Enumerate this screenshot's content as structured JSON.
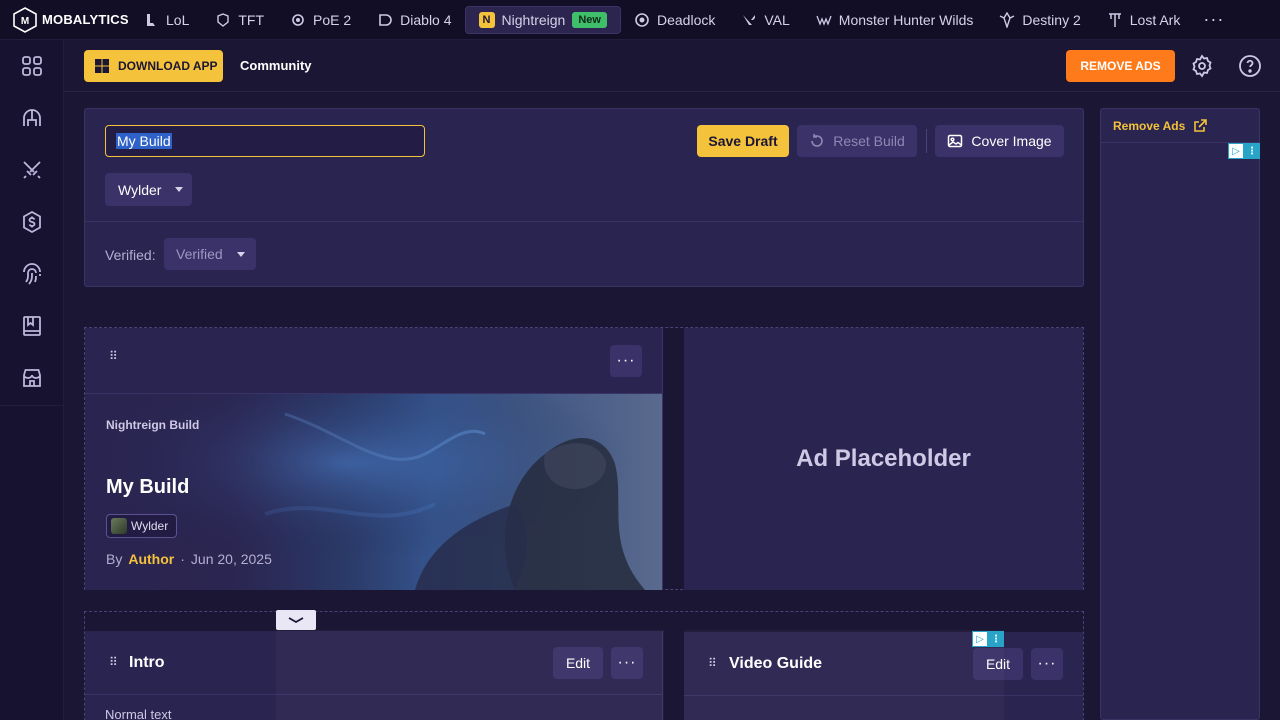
{
  "brand": {
    "name": "MOBALYTICS"
  },
  "games": [
    {
      "label": "LoL",
      "icon": "lol-icon"
    },
    {
      "label": "TFT",
      "icon": "tft-icon"
    },
    {
      "label": "PoE 2",
      "icon": "poe2-icon"
    },
    {
      "label": "Diablo 4",
      "icon": "diablo4-icon"
    },
    {
      "label": "Nightreign",
      "icon": "nightreign-icon",
      "badge": "N",
      "new_badge": "New",
      "active": true
    },
    {
      "label": "Deadlock",
      "icon": "deadlock-icon"
    },
    {
      "label": "VAL",
      "icon": "valorant-icon"
    },
    {
      "label": "Monster Hunter Wilds",
      "icon": "mhw-icon"
    },
    {
      "label": "Destiny 2",
      "icon": "destiny2-icon"
    },
    {
      "label": "Lost Ark",
      "icon": "lost-ark-icon"
    }
  ],
  "more": "···",
  "subbar": {
    "download_label": "DOWNLOAD APP",
    "community_label": "Community",
    "remove_ads_label": "REMOVE ADS"
  },
  "editor": {
    "build_name": "My Build",
    "class_value": "Wylder",
    "verified_label": "Verified:",
    "verified_value": "Verified",
    "save_draft": "Save Draft",
    "reset_build": "Reset Build",
    "cover_image": "Cover Image"
  },
  "ads_sidebar": {
    "remove_ads": "Remove Ads"
  },
  "hero": {
    "tag": "Nightreign Build",
    "title": "My Build",
    "class_chip": "Wylder",
    "by": "By",
    "author": "Author",
    "dot": "·",
    "date": "Jun 20, 2025"
  },
  "ad_placeholder": "Ad Placeholder",
  "intro": {
    "title": "Intro",
    "edit": "Edit",
    "text_style": "Normal text"
  },
  "video": {
    "title": "Video Guide",
    "edit": "Edit"
  },
  "colors": {
    "accent": "#f4c23b",
    "remove_ads": "#ff7a1a",
    "panel": "#2a2450",
    "background": "#1b1634"
  }
}
